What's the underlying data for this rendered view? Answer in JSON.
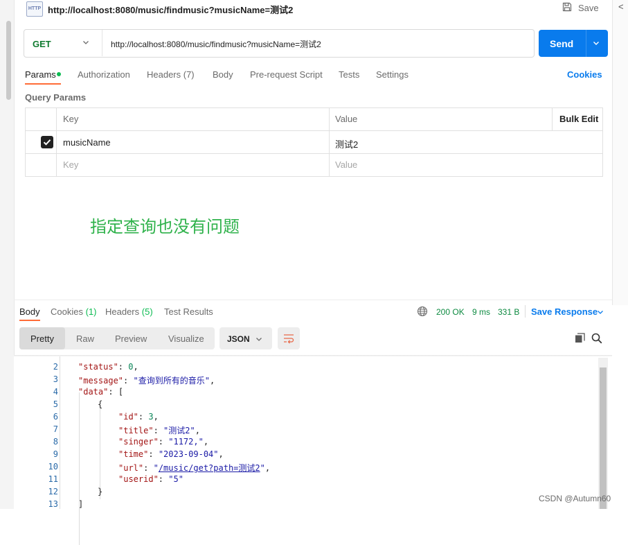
{
  "request": {
    "title": "http://localhost:8080/music/findmusic?musicName=测试2",
    "http_badge": "HTTP",
    "save_label": "Save",
    "method": "GET",
    "url": "http://localhost:8080/music/findmusic?musicName=测试2",
    "send_label": "Send",
    "tabs": [
      {
        "label": "Params"
      },
      {
        "label": "Authorization"
      },
      {
        "label": "Headers (7)"
      },
      {
        "label": "Body"
      },
      {
        "label": "Pre-request Script"
      },
      {
        "label": "Tests"
      },
      {
        "label": "Settings"
      }
    ],
    "cookies_label": "Cookies",
    "query_params_title": "Query Params",
    "table": {
      "headers": {
        "key": "Key",
        "value": "Value",
        "bulk_edit": "Bulk Edit"
      },
      "rows": [
        {
          "key": "musicName",
          "value": "测试2",
          "checked": true
        }
      ],
      "placeholder": {
        "key": "Key",
        "value": "Value"
      }
    }
  },
  "annotation": "指定查询也没有问题",
  "response": {
    "tabs": {
      "body": "Body",
      "cookies": "Cookies",
      "cookies_count": "(1)",
      "headers": "Headers",
      "headers_count": "(5)",
      "test_results": "Test Results"
    },
    "status": "200 OK",
    "time": "9 ms",
    "size": "331 B",
    "save_response": "Save Response",
    "view_modes": [
      "Pretty",
      "Raw",
      "Preview",
      "Visualize"
    ],
    "format": "JSON",
    "code_lines": [
      {
        "n": "2",
        "key": "\"status\"",
        "val": "0",
        "vtype": "num",
        "tail": ","
      },
      {
        "n": "3",
        "key": "\"message\"",
        "val": "\"查询到所有的音乐\"",
        "vtype": "str",
        "tail": ","
      },
      {
        "n": "4",
        "key": "\"data\"",
        "val": "",
        "vtype": "none",
        "tail": "["
      },
      {
        "n": "5",
        "text": "{"
      },
      {
        "n": "6",
        "key": "\"id\"",
        "val": "3",
        "vtype": "num",
        "tail": ","
      },
      {
        "n": "7",
        "key": "\"title\"",
        "val": "\"测试2\"",
        "vtype": "str",
        "tail": ","
      },
      {
        "n": "8",
        "key": "\"singer\"",
        "val": "\"1172,\"",
        "vtype": "str",
        "tail": ","
      },
      {
        "n": "9",
        "key": "\"time\"",
        "val": "\"2023-09-04\"",
        "vtype": "str",
        "tail": ","
      },
      {
        "n": "10",
        "key": "\"url\"",
        "val": "/music/get?path=测试2",
        "vtype": "link",
        "tail": ","
      },
      {
        "n": "11",
        "key": "\"userid\"",
        "val": "\"5\"",
        "vtype": "str",
        "tail": ""
      },
      {
        "n": "12",
        "text": "}"
      },
      {
        "n": "13",
        "text": "]"
      }
    ]
  },
  "watermark": "CSDN @Autumn60",
  "colors": {
    "accent": "#097bed",
    "tab_underline": "#ff6c37",
    "method_get": "#0f7b2f",
    "status_ok": "#0c8a40",
    "annotation": "#2fb24b"
  },
  "icons": [
    "http-icon",
    "save-icon",
    "chevron-down-icon",
    "checkbox-checked-icon",
    "globe-icon",
    "wrap-lines-icon",
    "copy-icon",
    "search-icon"
  ]
}
